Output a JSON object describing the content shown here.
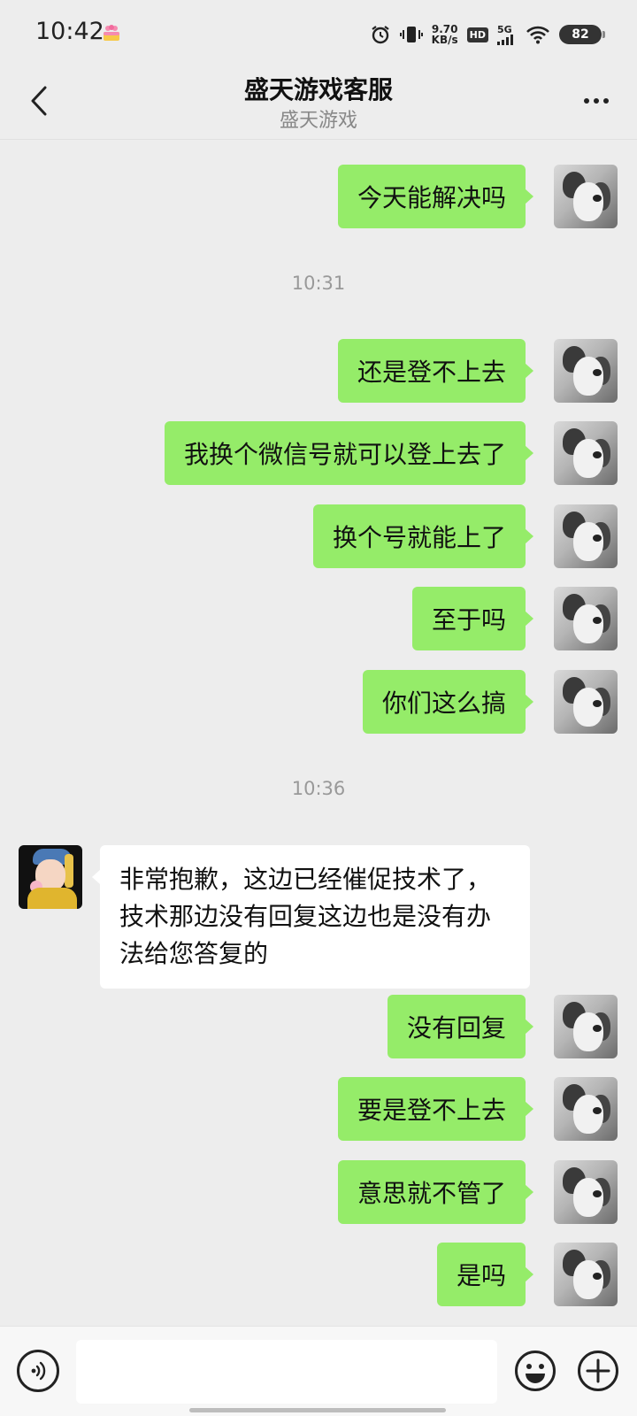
{
  "status_bar": {
    "time": "10:42",
    "net_speed_value": "9.70",
    "net_speed_unit": "KB/s",
    "hd_label": "HD",
    "signal_label": "5G",
    "battery": "82"
  },
  "header": {
    "title": "盛天游戏客服",
    "subtitle": "盛天游戏"
  },
  "chat": {
    "timestamps": [
      "10:31",
      "10:36"
    ],
    "messages": [
      {
        "sender": "me",
        "text": "今天能解决吗"
      },
      {
        "sender": "me",
        "text": "还是登不上去"
      },
      {
        "sender": "me",
        "text": "我换个微信号就可以登上去了"
      },
      {
        "sender": "me",
        "text": "换个号就能上了"
      },
      {
        "sender": "me",
        "text": "至于吗"
      },
      {
        "sender": "me",
        "text": "你们这么搞"
      },
      {
        "sender": "agent",
        "lines": [
          "非常抱歉，这边已经催促技术了，",
          "技术那边没有回复这边也是没有办",
          "法给您答复的"
        ]
      },
      {
        "sender": "me",
        "text": "没有回复"
      },
      {
        "sender": "me",
        "text": "要是登不上去"
      },
      {
        "sender": "me",
        "text": "意思就不管了"
      },
      {
        "sender": "me",
        "text": "是吗"
      }
    ]
  },
  "input_bar": {
    "value": "",
    "icons": [
      "voice-icon",
      "emoji-icon",
      "plus-icon"
    ]
  },
  "colors": {
    "outgoing_bubble": "#95ec69",
    "incoming_bubble": "#ffffff",
    "background": "#ededed"
  }
}
